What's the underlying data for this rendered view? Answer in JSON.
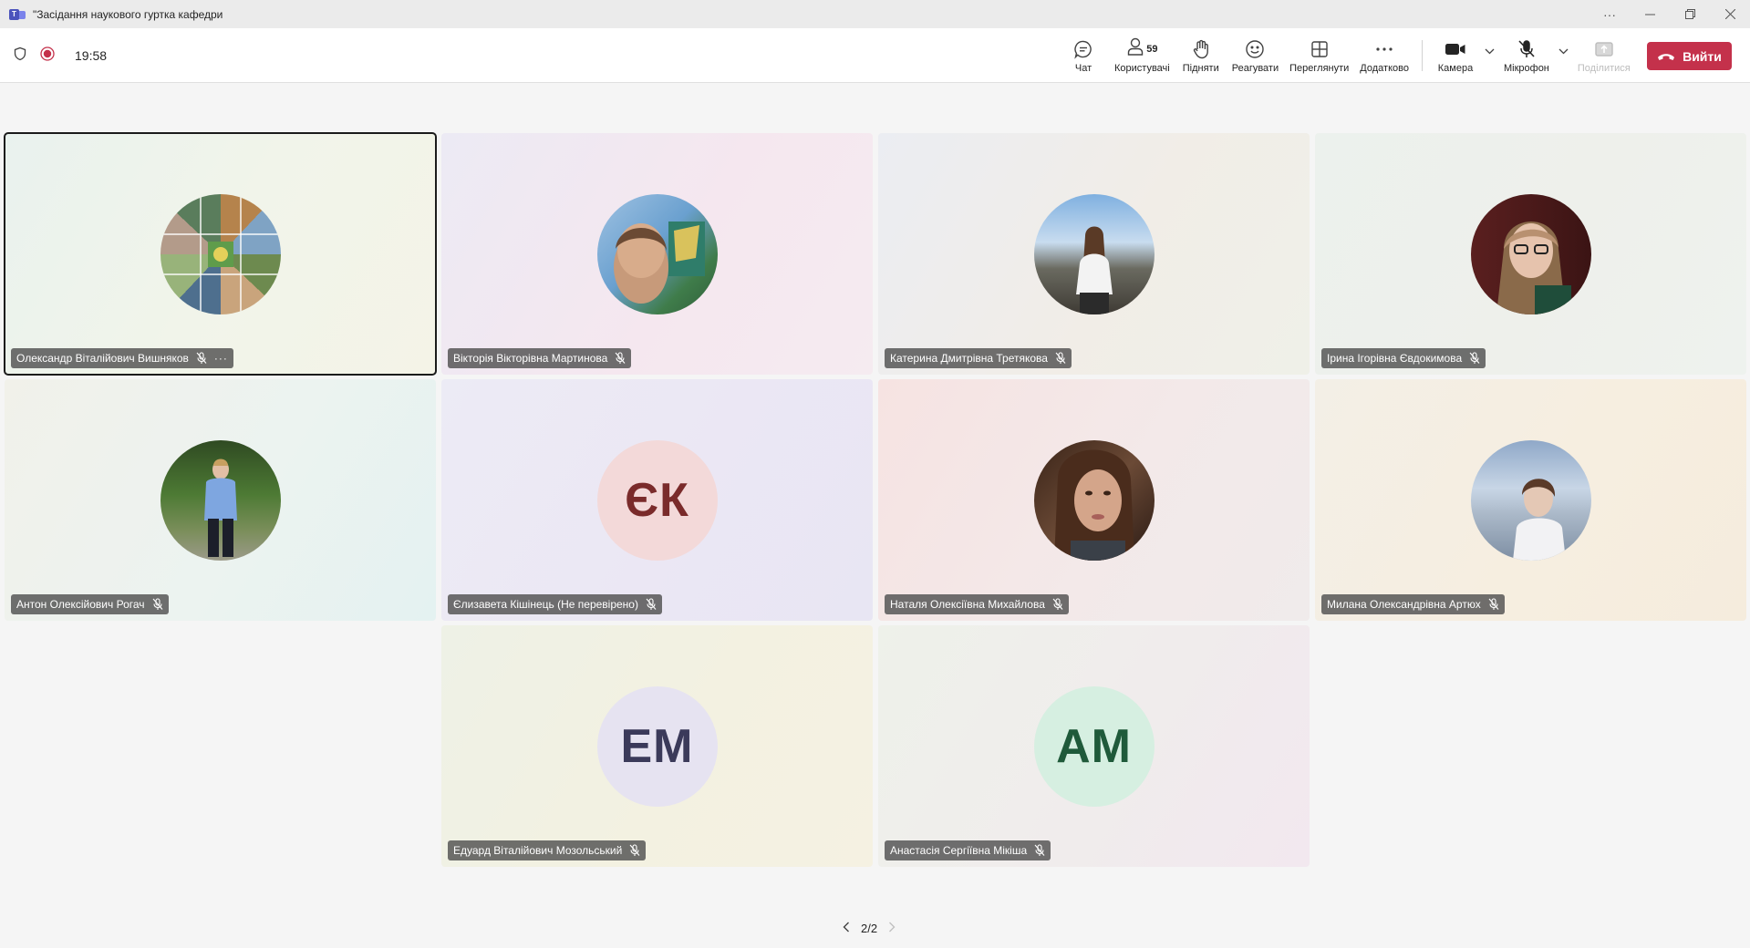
{
  "window": {
    "title": "\"Засідання наукового гуртка кафедри"
  },
  "meeting": {
    "timer": "19:58",
    "people_count": "59"
  },
  "toolbar": {
    "chat": "Чат",
    "people": "Користувачі",
    "raise": "Підняти",
    "react": "Реагувати",
    "view": "Переглянути",
    "more": "Додатково",
    "camera": "Камера",
    "mic": "Мікрофон",
    "share": "Поділитися",
    "leave": "Вийти"
  },
  "participants": [
    {
      "name": "Олександр Віталійович Вишняков",
      "initials": "",
      "active": true
    },
    {
      "name": "Вікторія Вікторівна Мартинова",
      "initials": ""
    },
    {
      "name": "Катерина Дмитрівна Третякова",
      "initials": ""
    },
    {
      "name": "Ірина Ігорівна Євдокимова",
      "initials": ""
    },
    {
      "name": "Антон Олексійович Рогач",
      "initials": ""
    },
    {
      "name": "Єлизавета Кішінець (Не перевірено)",
      "initials": "ЄК"
    },
    {
      "name": "Наталя Олексіївна Михайлова",
      "initials": ""
    },
    {
      "name": "Милана Олександрівна Артюх",
      "initials": ""
    },
    {
      "name": "Едуард Віталійович Мозольський",
      "initials": "ЕМ"
    },
    {
      "name": "Анастасія Сергіївна Мікіша",
      "initials": "АМ"
    }
  ],
  "pager": {
    "label": "2/2"
  },
  "colors": {
    "leave": "#c4314b",
    "brand": "#4b53bc",
    "initials_ek_bg": "#f3d9d9",
    "initials_ek_fg": "#7a2b2b",
    "initials_em_bg": "#e6e3f1",
    "initials_em_fg": "#3b3a5a",
    "initials_am_bg": "#d6efe1",
    "initials_am_fg": "#1f5a3a"
  }
}
